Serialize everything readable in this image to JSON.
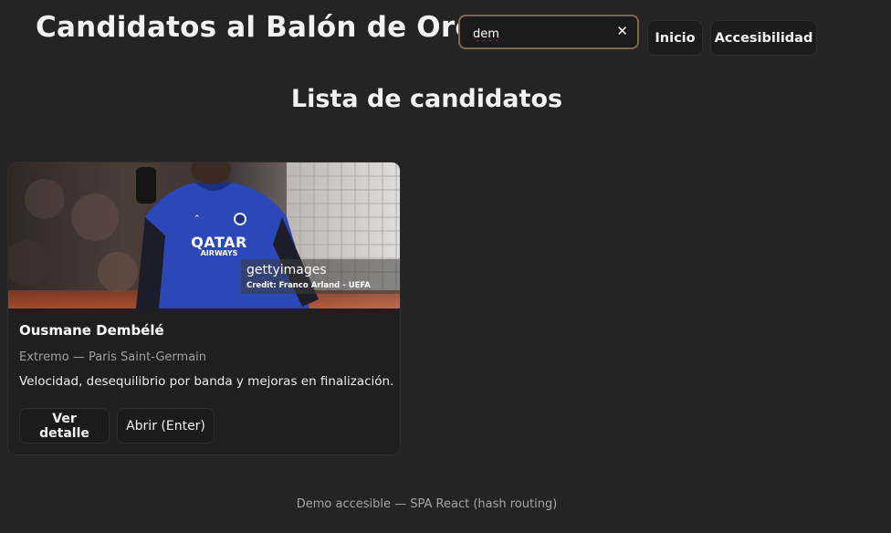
{
  "header": {
    "site_title": "Candidatos al Balón de Oro",
    "search": {
      "value": "dem",
      "placeholder": ""
    },
    "nav": {
      "home_label": "Inicio",
      "accessibility_label": "Accesibilidad"
    }
  },
  "main": {
    "section_title": "Lista de candidatos",
    "cards": [
      {
        "image": {
          "sponsor_text": "QATAR",
          "sponsor_subtext": "AIRWAYS",
          "watermark": "gettyimages",
          "credit": "Credit: Franco Arland - UEFA"
        },
        "name": "Ousmane Dembélé",
        "meta": "Extremo — Paris Saint-Germain",
        "description": "Velocidad, desequilibrio por banda y mejoras en finalización.",
        "detail_button_label": "Ver detalle",
        "open_button_label": "Abrir (Enter)"
      }
    ]
  },
  "footer": {
    "text": "Demo accesible — SPA React (hash routing)"
  },
  "icons": {
    "clear": "close-icon"
  },
  "colors": {
    "background": "#242424",
    "card_background": "#1f1f1f",
    "search_border": "#7a6a4a",
    "jersey": "#2c48b8"
  }
}
